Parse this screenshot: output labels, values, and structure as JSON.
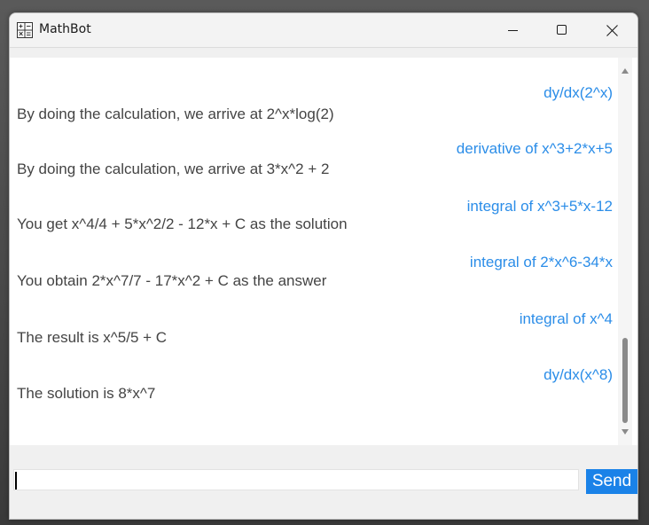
{
  "window": {
    "title": "MathBot"
  },
  "chat": {
    "messages": [
      {
        "role": "user",
        "text": "dy/dx(2^x)"
      },
      {
        "role": "bot",
        "text": "By doing the calculation, we arrive at 2^x*log(2)"
      },
      {
        "role": "user",
        "text": "derivative of x^3+2*x+5"
      },
      {
        "role": "bot",
        "text": "By doing the calculation, we arrive at 3*x^2 + 2"
      },
      {
        "role": "user",
        "text": "integral of x^3+5*x-12"
      },
      {
        "role": "bot",
        "text": "You get x^4/4 + 5*x^2/2 - 12*x + C as the solution"
      },
      {
        "role": "user",
        "text": "integral of 2*x^6-34*x"
      },
      {
        "role": "bot",
        "text": "You obtain 2*x^7/7 - 17*x^2 + C as the answer"
      },
      {
        "role": "user",
        "text": "integral of x^4"
      },
      {
        "role": "bot",
        "text": "The result is x^5/5 + C"
      },
      {
        "role": "user",
        "text": "dy/dx(x^8)"
      },
      {
        "role": "bot",
        "text": "The solution is 8*x^7"
      }
    ]
  },
  "input": {
    "value": "",
    "placeholder": ""
  },
  "send": {
    "label": "Send"
  },
  "colors": {
    "user_text": "#2b8de8",
    "bot_text": "#444444",
    "send_button": "#1a82e8"
  },
  "icons": {
    "app": "calculator-icon",
    "minimize": "minimize-icon",
    "maximize": "maximize-icon",
    "close": "close-icon"
  }
}
